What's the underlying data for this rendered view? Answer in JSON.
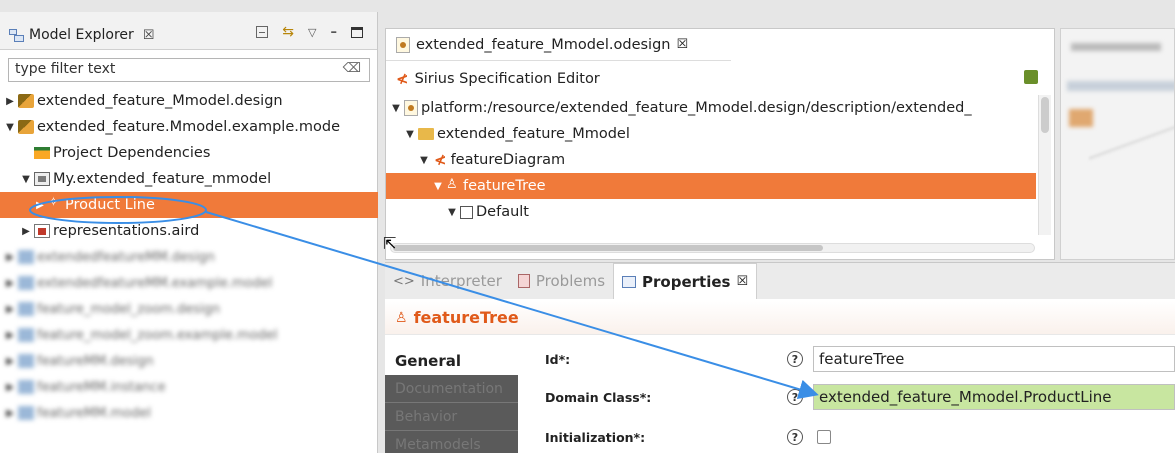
{
  "explorer": {
    "tab_label": "Model Explorer",
    "tab_close": "☒",
    "filter_placeholder": "type filter text",
    "items": [
      {
        "label": "extended_feature_Mmodel.design"
      },
      {
        "label": "extended_feature.Mmodel.example.mode"
      },
      {
        "label": "Project Dependencies"
      },
      {
        "label": "My.extended_feature_mmodel"
      },
      {
        "label": "Product Line"
      },
      {
        "label": "representations.aird"
      }
    ],
    "blurred_items": [
      "extendedfeatureMM.design",
      "extendedfeatureMM.example.model",
      "feature_model_zoom.design",
      "feature_model_zoom.example.model",
      "featureMM.design",
      "featureMM.instance",
      "featureMM.model"
    ]
  },
  "editor": {
    "tab_label": "extended_feature_Mmodel.odesign",
    "tab_close": "☒",
    "header": "Sirius Specification Editor",
    "tree": [
      {
        "label": "platform:/resource/extended_feature_Mmodel.design/description/extended_"
      },
      {
        "label": "extended_feature_Mmodel"
      },
      {
        "label": "featureDiagram"
      },
      {
        "label": "featureTree"
      },
      {
        "label": "Default"
      }
    ]
  },
  "properties": {
    "tabs": [
      {
        "label": "Interpreter"
      },
      {
        "label": "Problems"
      },
      {
        "label": "Properties"
      }
    ],
    "tab_close": "☒",
    "title": "featureTree",
    "side_tabs": [
      "General",
      "Documentation",
      "Behavior",
      "Metamodels"
    ],
    "fields": [
      {
        "label": "Id*:",
        "value": "featureTree"
      },
      {
        "label": "Domain Class*:",
        "value": "extended_feature_Mmodel.ProductLine"
      },
      {
        "label": "Initialization*:",
        "value": ""
      }
    ],
    "help_glyph": "?"
  },
  "colors": {
    "selection": "#f07a3a",
    "sirius_accent": "#e05a1a",
    "domain_class_bg": "#c8e6a0",
    "annotation": "#3a8ee6"
  }
}
